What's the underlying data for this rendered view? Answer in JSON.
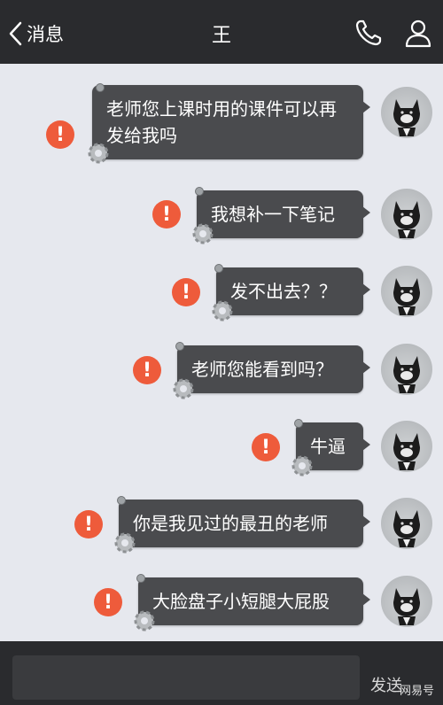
{
  "header": {
    "back_label": "消息",
    "title": "王"
  },
  "messages": [
    {
      "text": "老师您上课时用的课件可以再发给我吗",
      "status": "failed"
    },
    {
      "text": "我想补一下笔记",
      "status": "failed"
    },
    {
      "text": "发不出去？？",
      "status": "failed"
    },
    {
      "text": "老师您能看到吗？",
      "status": "failed"
    },
    {
      "text": "牛逼",
      "status": "failed"
    },
    {
      "text": "你是我见过的最丑的老师",
      "status": "failed"
    },
    {
      "text": "大脸盘子小短腿大屁股",
      "status": "failed"
    }
  ],
  "error_icon_text": "!",
  "footer": {
    "send_label": "发送",
    "watermark": "网易号"
  },
  "colors": {
    "header_bg": "#2a2b2e",
    "chat_bg": "#e6e8ee",
    "bubble_bg": "#4a4b4e",
    "error": "#ee5b3b"
  },
  "icons": [
    "chevron-left-icon",
    "phone-icon",
    "person-icon",
    "gear-icon",
    "error-icon",
    "dog-avatar"
  ]
}
